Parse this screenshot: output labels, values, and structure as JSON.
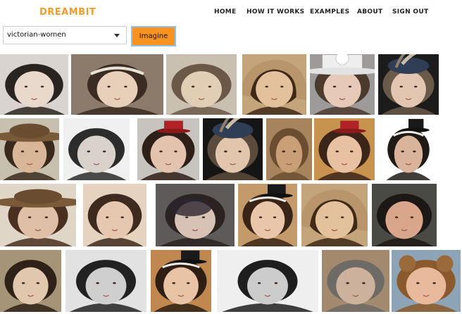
{
  "brand": "DREAMBIT",
  "nav": [
    {
      "label": "HOME"
    },
    {
      "label": "HOW IT WORKS"
    },
    {
      "label": "EXAMPLES"
    },
    {
      "label": "ABOUT"
    },
    {
      "label": "SIGN OUT"
    }
  ],
  "search": {
    "value": "victorian-women"
  },
  "imagine_label": "Imagine",
  "colors": {
    "accent": "#f7931e",
    "brand": "#f39c23"
  }
}
